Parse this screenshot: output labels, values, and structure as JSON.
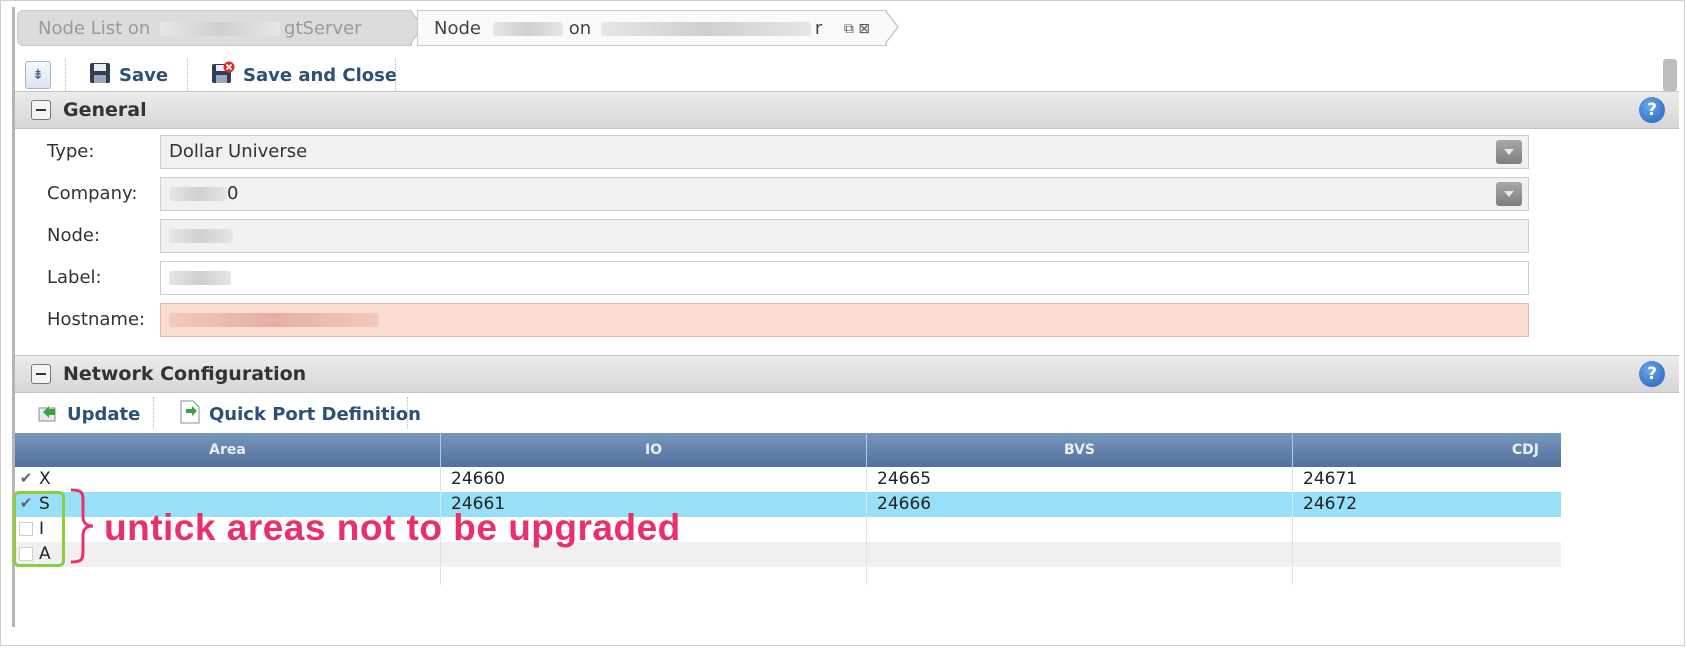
{
  "breadcrumb": {
    "crumb1_prefix": "Node List on",
    "crumb1_suffix": "gtServer",
    "crumb2_prefix": "Node",
    "crumb2_mid": "on",
    "crumb2_suffix": "r"
  },
  "toolbar": {
    "save_label": "Save",
    "save_close_label": "Save and Close"
  },
  "general": {
    "title": "General",
    "type_label": "Type:",
    "type_value": "Dollar Universe",
    "company_label": "Company:",
    "company_value": "0",
    "node_label": "Node:",
    "label_label": "Label:",
    "hostname_label": "Hostname:"
  },
  "network": {
    "title": "Network Configuration",
    "update_label": "Update",
    "quick_port_label": "Quick Port Definition"
  },
  "grid": {
    "columns": [
      "Area",
      "IO",
      "BVS",
      "CDJ"
    ],
    "rows": [
      {
        "area": "X",
        "checked": true,
        "io": "24660",
        "bvs": "24665",
        "cdj": "24671"
      },
      {
        "area": "S",
        "checked": true,
        "io": "24661",
        "bvs": "24666",
        "cdj": "24672"
      },
      {
        "area": "I",
        "checked": false,
        "io": "",
        "bvs": "",
        "cdj": ""
      },
      {
        "area": "A",
        "checked": false,
        "io": "",
        "bvs": "",
        "cdj": ""
      }
    ]
  },
  "annotation": {
    "text": "untick areas not to be upgraded"
  },
  "colors": {
    "selected_row": "#98e0f8",
    "annotation_text": "#ea2f6a",
    "annotation_box": "#8ccf3c",
    "error_field": "#fbdcd1"
  }
}
